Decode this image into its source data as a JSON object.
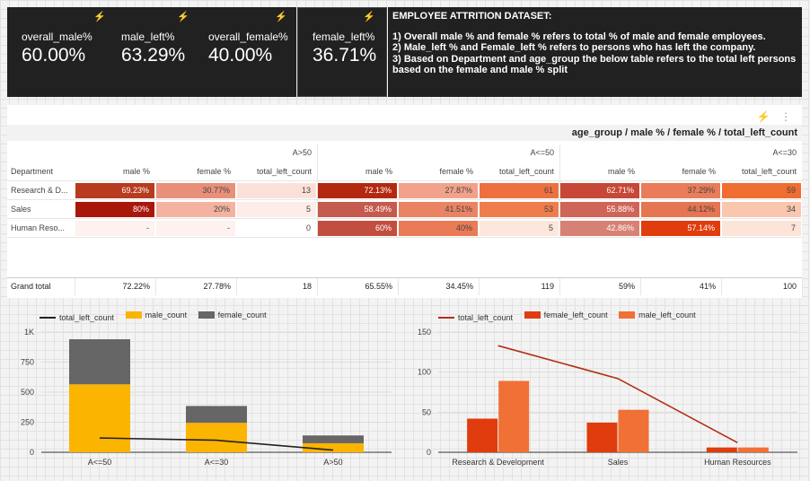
{
  "kpis": [
    {
      "label": "overall_male%",
      "value": "60.00%"
    },
    {
      "label": "male_left%",
      "value": "63.29%"
    },
    {
      "label": "overall_female%",
      "value": "40.00%"
    },
    {
      "label": "female_left%",
      "value": "36.71%"
    }
  ],
  "notes": {
    "title": "EMPLOYEE ATTRITION DATASET:",
    "lines": [
      "1) Overall male % and female % refers to total % of male and female employees.",
      "2) Male_left % and Female_left % refers to persons who has left the company.",
      "3) Based on Department and age_group the below table refers to the total left persons based on the female and male % split"
    ]
  },
  "pivot": {
    "title": "age_group / male % / female % / total_left_count",
    "row_header": "Department",
    "groups": [
      "A>50",
      "A<=50",
      "A<=30"
    ],
    "sub_columns": [
      "male %",
      "female %",
      "total_left_count"
    ],
    "rows": [
      {
        "dept": "Research & D...",
        "cells": [
          "69.23%",
          "30.77%",
          "13",
          "72.13%",
          "27.87%",
          "61",
          "62.71%",
          "37.29%",
          "59"
        ],
        "colors": [
          "#b83a1f",
          "#e8907a",
          "#fbe0d8",
          "#b3290f",
          "#f2a28a",
          "#ee7041",
          "#c74836",
          "#e97c5a",
          "#f06d32"
        ]
      },
      {
        "dept": "Sales",
        "cells": [
          "80%",
          "20%",
          "5",
          "58.49%",
          "41.51%",
          "53",
          "55.88%",
          "44.12%",
          "34"
        ],
        "colors": [
          "#a9170a",
          "#f4b3a1",
          "#fdece7",
          "#c55a4e",
          "#ea8363",
          "#ef7d4c",
          "#cf6558",
          "#e67552",
          "#f9c6ae"
        ]
      },
      {
        "dept": "Human Reso...",
        "cells": [
          "-",
          "-",
          "0",
          "60%",
          "40%",
          "5",
          "42.86%",
          "57.14%",
          "7"
        ],
        "colors": [
          "#fdf2ef",
          "#fdf2ef",
          "#ffffff",
          "#c24e40",
          "#eb7a56",
          "#fde6dc",
          "#d78174",
          "#e03c0e",
          "#fde4d8"
        ]
      }
    ],
    "grand_total_label": "Grand total",
    "grand_total": [
      "72.22%",
      "27.78%",
      "18",
      "65.55%",
      "34.45%",
      "119",
      "59%",
      "41%",
      "100"
    ]
  },
  "chart_data": [
    {
      "type": "bar",
      "stacked": true,
      "categories": [
        "A<=50",
        "A<=30",
        "A>50"
      ],
      "series": [
        {
          "name": "total_left_count",
          "kind": "line",
          "values": [
            119,
            100,
            18
          ],
          "color": "#212121"
        },
        {
          "name": "male_count",
          "kind": "bar",
          "values": [
            565,
            245,
            75
          ],
          "color": "#fbb400"
        },
        {
          "name": "female_count",
          "kind": "bar",
          "values": [
            375,
            140,
            65
          ],
          "color": "#666666"
        }
      ],
      "yticks": [
        "0",
        "250",
        "500",
        "750",
        "1K"
      ],
      "ylim": [
        0,
        1000
      ]
    },
    {
      "type": "bar",
      "categories": [
        "Research & Development",
        "Sales",
        "Human Resources"
      ],
      "series": [
        {
          "name": "total_left_count",
          "kind": "line",
          "values": [
            133,
            92,
            12
          ],
          "color": "#b22e11"
        },
        {
          "name": "female_left_count",
          "kind": "bar",
          "values": [
            42,
            37,
            6
          ],
          "color": "#e03c0e"
        },
        {
          "name": "male_left_count",
          "kind": "bar",
          "values": [
            89,
            53,
            6
          ],
          "color": "#f07036"
        }
      ],
      "yticks": [
        "0",
        "50",
        "100",
        "150"
      ],
      "ylim": [
        0,
        150
      ]
    }
  ]
}
